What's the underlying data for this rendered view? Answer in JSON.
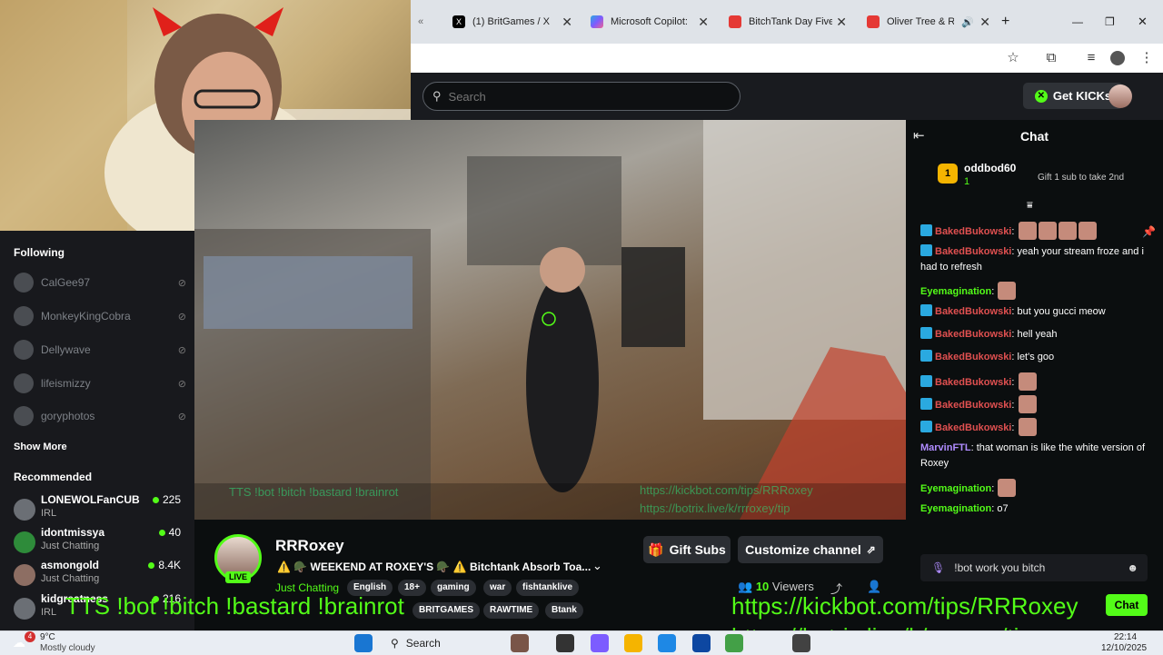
{
  "browser": {
    "tabs": [
      {
        "label": "(1) BritGames / X",
        "icon_color": "#000000"
      },
      {
        "label": "Microsoft Copilot: Yo",
        "icon_color": "#7c5cff"
      },
      {
        "label": "BitchTank Day Five R",
        "icon_color": "#e53935"
      },
      {
        "label": "Oliver Tree & Ro",
        "icon_color": "#e53935"
      }
    ],
    "new_tab_label": "+",
    "window_controls": {
      "minimize": "—",
      "maximize": "❐",
      "close": "✕"
    }
  },
  "header": {
    "search_placeholder": "Search",
    "get_kicks_label": "Get KICKs"
  },
  "sidebar": {
    "following_title": "Following",
    "following": [
      {
        "name": "CalGee97"
      },
      {
        "name": "MonkeyKingCobra"
      },
      {
        "name": "Dellywave"
      },
      {
        "name": "lifeismizzy"
      },
      {
        "name": "goryphotos"
      }
    ],
    "show_more_label": "Show More",
    "recommended_title": "Recommended",
    "recommended": [
      {
        "name": "LONEWOLFanCUB",
        "category": "IRL",
        "viewers": "225"
      },
      {
        "name": "idontmissya",
        "category": "Just Chatting",
        "viewers": "40"
      },
      {
        "name": "asmongold",
        "category": "Just Chatting",
        "viewers": "8.4K"
      },
      {
        "name": "kidgreatness",
        "category": "IRL",
        "viewers": "216"
      }
    ]
  },
  "video": {
    "tts_text": "TTS !bot !bitch !bastard !brainrot",
    "links": [
      "https://kickbot.com/tips/RRRoxey",
      "https://botrix.live/k/rrroxey/tip"
    ]
  },
  "stream": {
    "channel_name": "RRRoxey",
    "live_label": "LIVE",
    "title": "⚠️ 🪖 WEEKEND AT ROXEY'S 🪖 ⚠️ Bitchtank Absorb Toa...",
    "category": "Just Chatting",
    "tags": [
      "English",
      "18+",
      "gaming",
      "war",
      "fishtanklive",
      "BRITGAMES",
      "RAWTIME",
      "Btank"
    ],
    "gift_subs_label": "Gift Subs",
    "customize_label": "Customize channel",
    "viewers_count": "10",
    "viewers_label": "Viewers"
  },
  "chat": {
    "title": "Chat",
    "top_gifter": {
      "name": "oddbod60",
      "rank": "1",
      "count": "1",
      "prompt": "Gift 1 sub to take 2nd"
    },
    "messages": [
      {
        "user": "BakedBukowski",
        "text": "",
        "color": "#e05050",
        "emotes": 4
      },
      {
        "user": "BakedBukowski",
        "text": "yeah your stream froze and i had to refresh",
        "color": "#e05050",
        "emotes": 0
      },
      {
        "user": "Eyemagination",
        "text": "",
        "color": "#53fc18",
        "emotes": 1
      },
      {
        "user": "BakedBukowski",
        "text": "but you gucci meow",
        "color": "#e05050",
        "emotes": 0
      },
      {
        "user": "BakedBukowski",
        "text": "hell yeah",
        "color": "#e05050",
        "emotes": 0
      },
      {
        "user": "BakedBukowski",
        "text": "let's goo",
        "color": "#e05050",
        "emotes": 0
      },
      {
        "user": "BakedBukowski",
        "text": "",
        "color": "#e05050",
        "emotes": 1
      },
      {
        "user": "BakedBukowski",
        "text": "",
        "color": "#e05050",
        "emotes": 1
      },
      {
        "user": "BakedBukowski",
        "text": "",
        "color": "#e05050",
        "emotes": 1
      },
      {
        "user": "MarvinFTL",
        "text": "that woman is like the white version of Roxey",
        "color": "#b08cff",
        "emotes": 0
      },
      {
        "user": "Eyemagination",
        "text": "",
        "color": "#53fc18",
        "emotes": 1
      },
      {
        "user": "Eyemagination",
        "text": "o7",
        "color": "#53fc18",
        "emotes": 0
      }
    ],
    "input_value": "!bot work you bitch",
    "send_label": "Chat"
  },
  "overlay": {
    "tts_text": "TTS !bot !bitch !bastard !brainrot",
    "link1": "https://kickbot.com/tips/RRRoxey",
    "link2": "https://botrix.live/k/rrroxey/tip"
  },
  "taskbar": {
    "weather_temp": "9°C",
    "weather_desc": "Mostly cloudy",
    "weather_badge": "4",
    "search_label": "Search",
    "time": "22:14",
    "date": "12/10/2025"
  }
}
